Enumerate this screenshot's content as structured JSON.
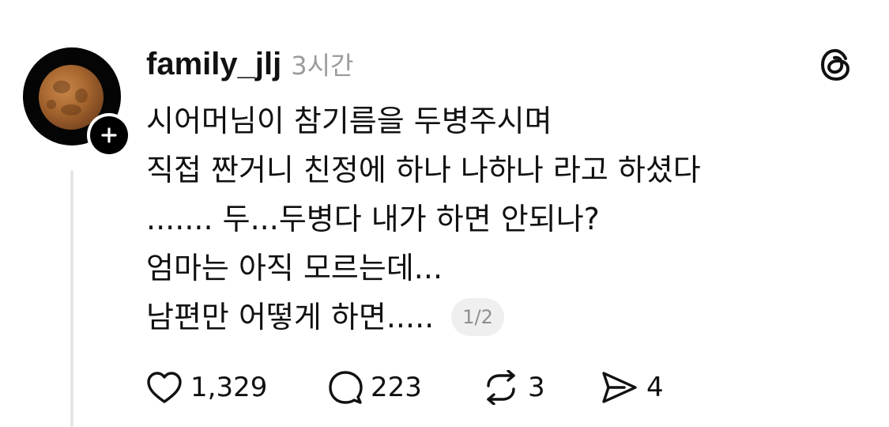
{
  "post": {
    "username": "family_jlj",
    "timestamp": "3시간",
    "lines": [
      "시어머님이 참기름을 두병주시며",
      "직접 짠거니 친정에 하나 나하나 라고 하셨다",
      "....... 두...두병다 내가 하면 안되나?",
      "엄마는 아직 모르는데...",
      "남편만 어떻게 하면....."
    ],
    "page_indicator": "1/2",
    "follow_badge_symbol": "+"
  },
  "actions": {
    "likes": "1,329",
    "replies": "223",
    "reposts": "3",
    "shares": "4"
  },
  "icons": {
    "app_logo": "threads-logo-icon",
    "like": "heart-icon",
    "reply": "comment-bubble-icon",
    "repost": "repost-icon",
    "share": "send-icon"
  },
  "colors": {
    "text": "#111111",
    "muted": "#9b9b9b",
    "thread_line": "#e6e6e6"
  }
}
